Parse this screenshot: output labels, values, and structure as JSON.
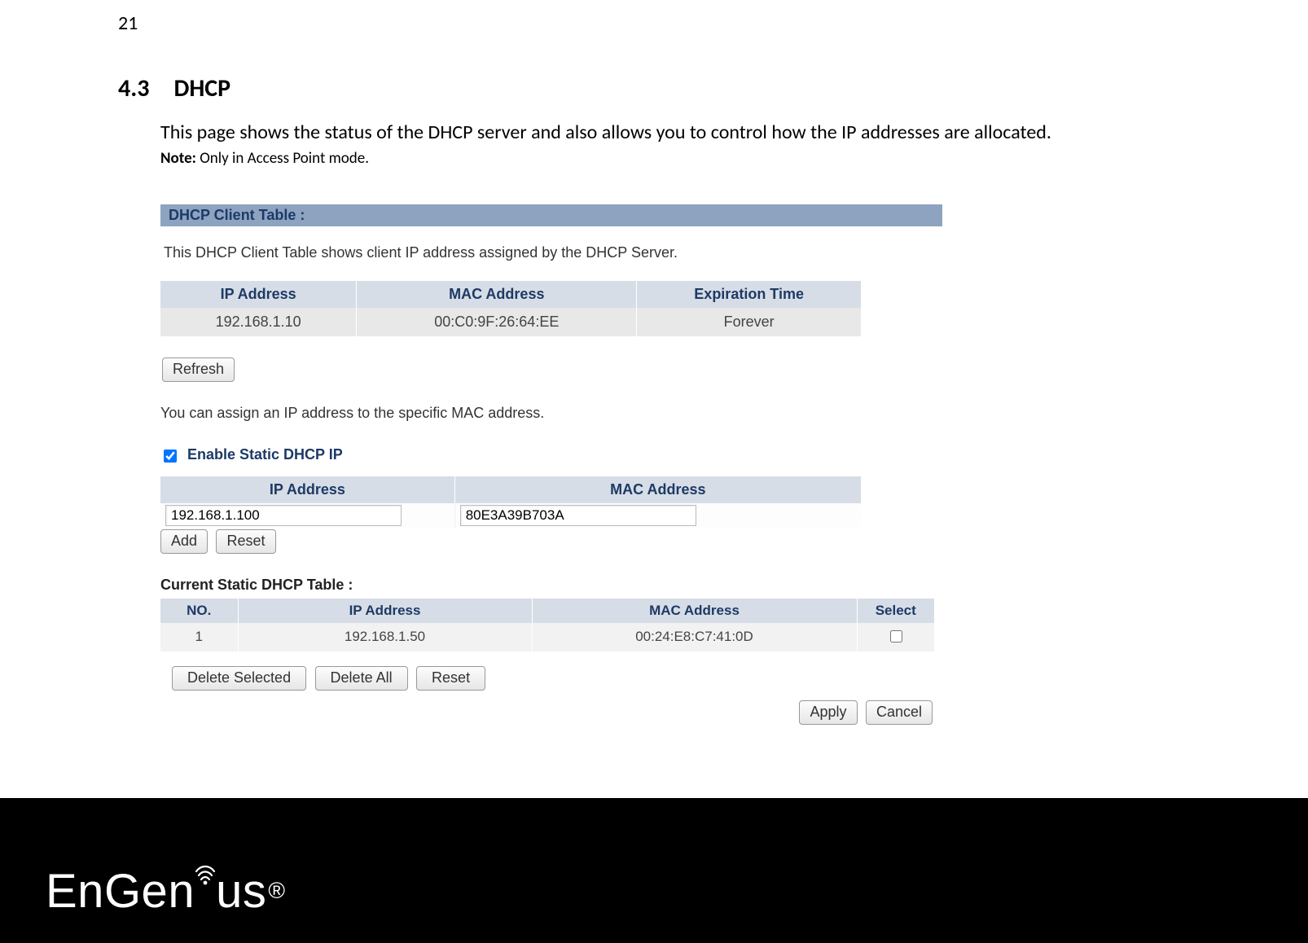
{
  "page_number": "21",
  "section": {
    "number": "4.3",
    "title": "DHCP"
  },
  "intro": "This page shows the status of the DHCP server and also allows you to control how the IP addresses are allocated.",
  "note_label": "Note:",
  "note_text": " Only in Access Point mode.",
  "panel": {
    "header": "DHCP Client Table :",
    "desc": "This DHCP Client Table shows client IP address assigned by the DHCP Server.",
    "columns": {
      "ip": "IP Address",
      "mac": "MAC Address",
      "exp": "Expiration Time"
    },
    "row": {
      "ip": "192.168.1.10",
      "mac": "00:C0:9F:26:64:EE",
      "exp": "Forever"
    }
  },
  "refresh_label": "Refresh",
  "assign_desc": "You can assign an IP address to the specific MAC address.",
  "enable_static_label": "Enable Static DHCP IP",
  "input_table": {
    "columns": {
      "ip": "IP Address",
      "mac": "MAC Address"
    },
    "ip_value": "192.168.1.100",
    "mac_value": "80E3A39B703A"
  },
  "add_label": "Add",
  "reset_label": "Reset",
  "static_table_title": "Current Static DHCP Table :",
  "static_table": {
    "columns": {
      "no": "NO.",
      "ip": "IP Address",
      "mac": "MAC Address",
      "sel": "Select"
    },
    "row": {
      "no": "1",
      "ip": "192.168.1.50",
      "mac": "00:24:E8:C7:41:0D"
    }
  },
  "delete_selected_label": "Delete Selected",
  "delete_all_label": "Delete All",
  "reset2_label": "Reset",
  "apply_label": "Apply",
  "cancel_label": "Cancel",
  "logo": {
    "part1": "EnGen",
    "part2": "us",
    "reg": "®"
  }
}
